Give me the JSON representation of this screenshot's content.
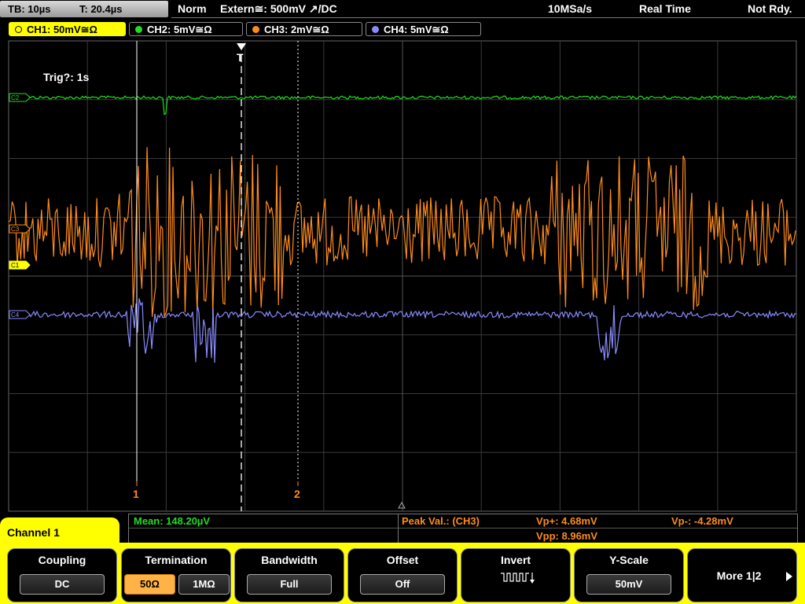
{
  "status": {
    "timebase": "TB: 10µs",
    "trigger_time": "T: 20.4µs",
    "mode": "Norm",
    "trigger_source": "Extern≅: 500mV ↗/DC",
    "sample_rate": "10MSa/s",
    "acq_mode": "Real Time",
    "ready": "Not Rdy."
  },
  "channels": [
    {
      "label": "CH1: 50mV≅Ω",
      "color": "#ffff00"
    },
    {
      "label": "CH2: 5mV≅Ω",
      "color": "#22dd22"
    },
    {
      "label": "CH3: 2mV≅Ω",
      "color": "#ff8c1a"
    },
    {
      "label": "CH4: 5mV≅Ω",
      "color": "#8a8aff"
    }
  ],
  "screen": {
    "trig_info": "Trig?: 1s",
    "trigger_marker": "T",
    "cursor1_label": "1",
    "cursor2_label": "2",
    "markers": [
      "C2",
      "C3",
      "C1",
      "C4"
    ]
  },
  "measurements": {
    "mean": "Mean: 148.20µV",
    "peak_label": "Peak Val.:  (CH3)",
    "vp_plus": "Vp+: 4.68mV",
    "vp_minus": "Vp-: -4.28mV",
    "vpp": "Vpp: 8.96mV"
  },
  "menu": {
    "title": "Channel 1",
    "coupling": {
      "label": "Coupling",
      "value": "DC"
    },
    "termination": {
      "label": "Termination",
      "opt1": "50Ω",
      "opt2": "1MΩ",
      "selected": "50Ω"
    },
    "bandwidth": {
      "label": "Bandwidth",
      "value": "Full"
    },
    "offset": {
      "label": "Offset",
      "value": "Off"
    },
    "invert": {
      "label": "Invert"
    },
    "yscale": {
      "label": "Y-Scale",
      "value": "50mV"
    },
    "more": {
      "label": "More 1|2"
    }
  },
  "colors": {
    "ch1": "#ffff00",
    "ch2": "#22dd22",
    "ch3": "#ff8c1a",
    "ch4": "#8a8aff",
    "menu": "#ffff00"
  }
}
